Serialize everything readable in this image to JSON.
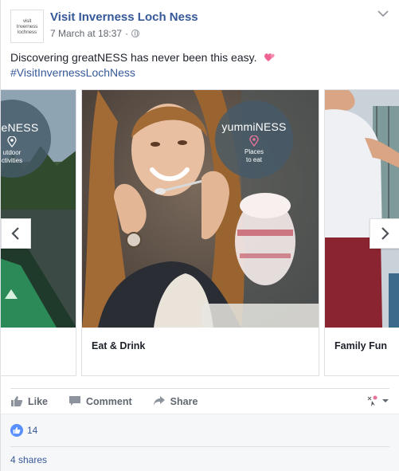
{
  "post": {
    "page_name": "Visit Inverness Loch Ness",
    "avatar_lines": [
      "visit",
      "Inverness",
      "lochness"
    ],
    "timestamp": "7 March at 18:37",
    "separator": "·",
    "text": "Discovering greatNESS has never been this easy.",
    "hashtag": "#VisitInvernessLochNess"
  },
  "carousel": {
    "cards": [
      {
        "badge_title": "omeNESS",
        "badge_sub": [
          "utdoor",
          "ctivities"
        ],
        "title": ""
      },
      {
        "badge_title": "yummiNESS",
        "badge_sub": [
          "Places",
          "to eat"
        ],
        "title": "Eat & Drink"
      },
      {
        "badge_title": "",
        "badge_sub": [],
        "title": "Family Fun"
      }
    ]
  },
  "actions": {
    "like": "Like",
    "comment": "Comment",
    "share": "Share"
  },
  "stats": {
    "likes": "14",
    "shares": "4 shares"
  },
  "colors": {
    "link": "#365899",
    "like_blue": "#5890ff",
    "badge": "#465a69",
    "badge_pin": "#e8739a"
  }
}
